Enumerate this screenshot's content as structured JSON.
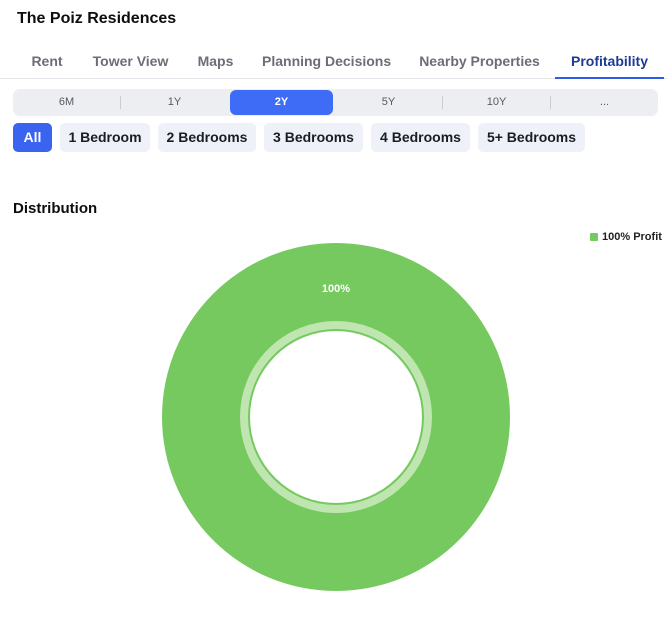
{
  "header": {
    "title": "The Poiz Residences"
  },
  "tabs": [
    {
      "label": "Rent"
    },
    {
      "label": "Tower View"
    },
    {
      "label": "Maps"
    },
    {
      "label": "Planning Decisions"
    },
    {
      "label": "Nearby Properties"
    },
    {
      "label": "Profitability",
      "active": true
    }
  ],
  "periods": [
    {
      "label": "6M"
    },
    {
      "label": "1Y"
    },
    {
      "label": "2Y",
      "active": true
    },
    {
      "label": "5Y"
    },
    {
      "label": "10Y"
    },
    {
      "label": "..."
    }
  ],
  "bedroom_filters": [
    {
      "label": "All",
      "active": true
    },
    {
      "label": "1 Bedroom"
    },
    {
      "label": "2 Bedrooms"
    },
    {
      "label": "3 Bedrooms"
    },
    {
      "label": "4 Bedrooms"
    },
    {
      "label": "5+ Bedrooms"
    }
  ],
  "distribution": {
    "title": "Distribution",
    "legend_label": "100% Profit",
    "slice_label": "100%"
  },
  "colors": {
    "accent": "#3f6cf6",
    "profit": "#76c95e",
    "profit_light": "#bfe6b0"
  },
  "chart_data": {
    "type": "pie",
    "categories": [
      "100% Profit"
    ],
    "values": [
      100
    ],
    "data_labels": [
      "100%"
    ],
    "title": "Distribution",
    "legend": "top-right"
  }
}
